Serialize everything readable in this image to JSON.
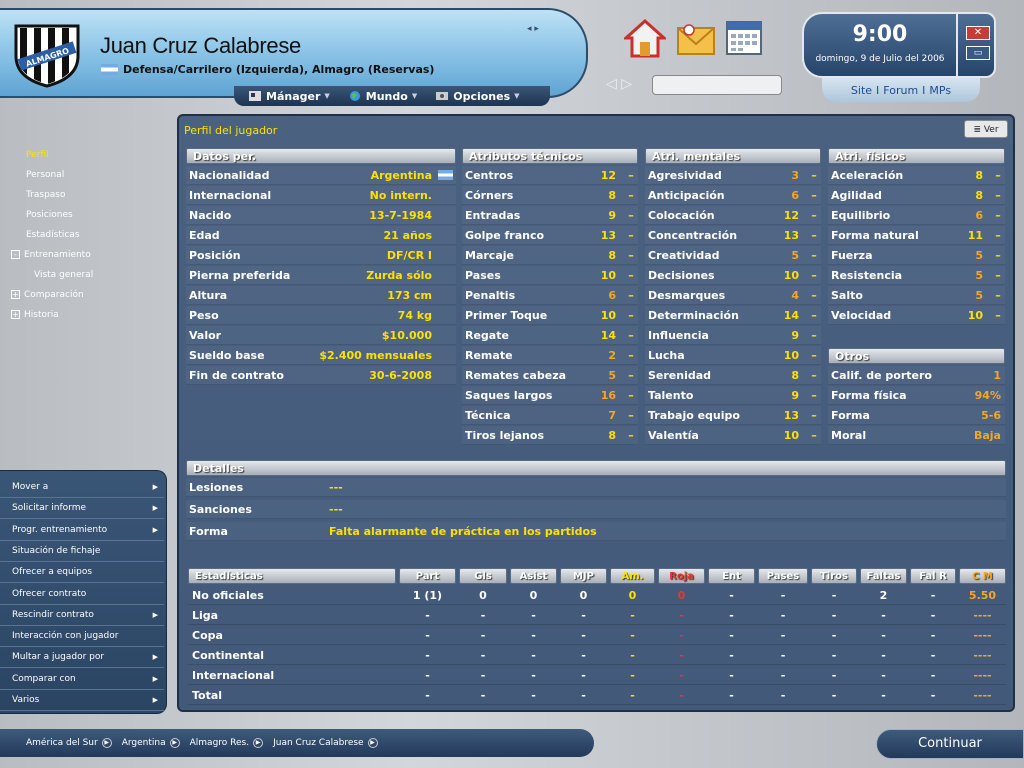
{
  "header": {
    "player_name": "Juan Cruz Calabrese",
    "player_subtitle": "Defensa/Carrilero (Izquierda), Almagro (Reservas)",
    "crest_text": "ALMAGRO",
    "menu": [
      {
        "label": "Mánager",
        "icon": "manager-icon"
      },
      {
        "label": "Mundo",
        "icon": "globe-icon"
      },
      {
        "label": "Opciones",
        "icon": "options-icon"
      }
    ],
    "arrows": "◂ ▸",
    "nav_arrows": "◁ ▷"
  },
  "clock": {
    "time": "9:00",
    "date": "domingo, 9 de Julio del 2006"
  },
  "window": {
    "close": "✕",
    "restore": "▭"
  },
  "site_links": [
    "Site",
    "Forum",
    "MPs"
  ],
  "site_sep": "I",
  "leftnav": [
    {
      "label": "Perfil",
      "active": true,
      "indent": 0,
      "box": ""
    },
    {
      "label": "Personal",
      "indent": 0,
      "box": ""
    },
    {
      "label": "Traspaso",
      "indent": 0,
      "box": ""
    },
    {
      "label": "Posiciones",
      "indent": 0,
      "box": ""
    },
    {
      "label": "Estadísticas",
      "indent": 0,
      "box": ""
    },
    {
      "label": "Entrenamiento",
      "indent": 0,
      "box": "-"
    },
    {
      "label": "Vista general",
      "indent": 1,
      "box": ""
    },
    {
      "label": "Comparación",
      "indent": 0,
      "box": "+"
    },
    {
      "label": "Historia",
      "indent": 0,
      "box": "+"
    }
  ],
  "actions": [
    {
      "label": "Mover a",
      "chev": true
    },
    {
      "label": "Solicitar informe",
      "chev": true
    },
    {
      "label": "Progr. entrenamiento",
      "chev": true
    },
    {
      "label": "Situación de fichaje",
      "chev": false
    },
    {
      "label": "Ofrecer a equipos",
      "chev": false
    },
    {
      "label": "Ofrecer contrato",
      "chev": false
    },
    {
      "label": "Rescindir contrato",
      "chev": true
    },
    {
      "label": "Interacción con jugador",
      "chev": false
    },
    {
      "label": "Multar a jugador por",
      "chev": true
    },
    {
      "label": "Comparar con",
      "chev": true
    },
    {
      "label": "Varios",
      "chev": true
    }
  ],
  "panel": {
    "title": "Perfil del jugador",
    "ver_label": "Ver"
  },
  "datos": {
    "header": "Datos per.",
    "rows": [
      {
        "label": "Nacionalidad",
        "value": "Argentina",
        "flag": true
      },
      {
        "label": "Internacional",
        "value": "No intern."
      },
      {
        "label": "Nacido",
        "value": "13-7-1984"
      },
      {
        "label": "Edad",
        "value": "21 años"
      },
      {
        "label": "Posición",
        "value": "DF/CR I"
      },
      {
        "label": "Pierna preferida",
        "value": "Zurda sólo"
      },
      {
        "label": "Altura",
        "value": "173 cm"
      },
      {
        "label": "Peso",
        "value": "74 kg"
      },
      {
        "label": "Valor",
        "value": "$10.000"
      },
      {
        "label": "Sueldo base",
        "value": "$2.400 mensuales"
      },
      {
        "label": "Fin de contrato",
        "value": "30-6-2008"
      }
    ]
  },
  "tecnicos": {
    "header": "Atributos técnicos",
    "rows": [
      {
        "label": "Centros",
        "value": "12",
        "tone": "y"
      },
      {
        "label": "Córners",
        "value": "8",
        "tone": "y"
      },
      {
        "label": "Entradas",
        "value": "9",
        "tone": "y"
      },
      {
        "label": "Golpe franco",
        "value": "13",
        "tone": "y"
      },
      {
        "label": "Marcaje",
        "value": "8",
        "tone": "y"
      },
      {
        "label": "Pases",
        "value": "10",
        "tone": "y"
      },
      {
        "label": "Penaltis",
        "value": "6",
        "tone": "o"
      },
      {
        "label": "Primer Toque",
        "value": "10",
        "tone": "y"
      },
      {
        "label": "Regate",
        "value": "14",
        "tone": "y"
      },
      {
        "label": "Remate",
        "value": "2",
        "tone": "o"
      },
      {
        "label": "Remates cabeza",
        "value": "5",
        "tone": "o"
      },
      {
        "label": "Saques largos",
        "value": "16",
        "tone": "o"
      },
      {
        "label": "Técnica",
        "value": "7",
        "tone": "o"
      },
      {
        "label": "Tiros lejanos",
        "value": "8",
        "tone": "y"
      }
    ]
  },
  "mentales": {
    "header": "Atri. mentales",
    "rows": [
      {
        "label": "Agresividad",
        "value": "3",
        "tone": "o"
      },
      {
        "label": "Anticipación",
        "value": "6",
        "tone": "o"
      },
      {
        "label": "Colocación",
        "value": "12",
        "tone": "y"
      },
      {
        "label": "Concentración",
        "value": "13",
        "tone": "y"
      },
      {
        "label": "Creatividad",
        "value": "5",
        "tone": "o"
      },
      {
        "label": "Decisiones",
        "value": "10",
        "tone": "y"
      },
      {
        "label": "Desmarques",
        "value": "4",
        "tone": "o"
      },
      {
        "label": "Determinación",
        "value": "14",
        "tone": "y"
      },
      {
        "label": "Influencia",
        "value": "9",
        "tone": "y"
      },
      {
        "label": "Lucha",
        "value": "10",
        "tone": "y"
      },
      {
        "label": "Serenidad",
        "value": "8",
        "tone": "y"
      },
      {
        "label": "Talento",
        "value": "9",
        "tone": "y"
      },
      {
        "label": "Trabajo equipo",
        "value": "13",
        "tone": "y"
      },
      {
        "label": "Valentía",
        "value": "10",
        "tone": "y"
      }
    ]
  },
  "fisicos": {
    "header": "Atri. físicos",
    "rows": [
      {
        "label": "Aceleración",
        "value": "8",
        "tone": "y"
      },
      {
        "label": "Agilidad",
        "value": "8",
        "tone": "y"
      },
      {
        "label": "Equilibrio",
        "value": "6",
        "tone": "o"
      },
      {
        "label": "Forma natural",
        "value": "11",
        "tone": "y"
      },
      {
        "label": "Fuerza",
        "value": "5",
        "tone": "o"
      },
      {
        "label": "Resistencia",
        "value": "5",
        "tone": "o"
      },
      {
        "label": "Salto",
        "value": "5",
        "tone": "o"
      },
      {
        "label": "Velocidad",
        "value": "10",
        "tone": "y"
      }
    ]
  },
  "otros": {
    "header": "Otros",
    "rows": [
      {
        "label": "Calif. de portero",
        "value": "1",
        "tone": "o"
      },
      {
        "label": "Forma física",
        "value": "94%",
        "tone": "o"
      },
      {
        "label": "Forma",
        "value": "5-6",
        "tone": "o"
      },
      {
        "label": "Moral",
        "value": "Baja",
        "tone": "o"
      }
    ]
  },
  "dash": "–",
  "detalles": {
    "header": "Detalles",
    "rows": [
      {
        "label": "Lesiones",
        "value": "---"
      },
      {
        "label": "Sanciones",
        "value": "---"
      },
      {
        "label": "Forma",
        "value": "Falta alarmante de práctica en los partidos"
      }
    ]
  },
  "stats": {
    "columns": [
      "Estadísticas",
      "Part",
      "Gls",
      "Asist",
      "MJP",
      "Am.",
      "Roja",
      "Ent",
      "Pases",
      "Tiros",
      "Faltas",
      "Fal R",
      "C M"
    ],
    "rows": [
      {
        "label": "No oficiales",
        "cells": [
          "1 (1)",
          "0",
          "0",
          "0",
          "0",
          "0",
          "-",
          "-",
          "-",
          "2",
          "-",
          "5.50"
        ]
      },
      {
        "label": "Liga",
        "cells": [
          "-",
          "-",
          "-",
          "-",
          "-",
          "-",
          "-",
          "-",
          "-",
          "-",
          "-",
          "----"
        ]
      },
      {
        "label": "Copa",
        "cells": [
          "-",
          "-",
          "-",
          "-",
          "-",
          "-",
          "-",
          "-",
          "-",
          "-",
          "-",
          "----"
        ]
      },
      {
        "label": "Continental",
        "cells": [
          "-",
          "-",
          "-",
          "-",
          "-",
          "-",
          "-",
          "-",
          "-",
          "-",
          "-",
          "----"
        ]
      },
      {
        "label": "Internacional",
        "cells": [
          "-",
          "-",
          "-",
          "-",
          "-",
          "-",
          "-",
          "-",
          "-",
          "-",
          "-",
          "----"
        ]
      },
      {
        "label": "Total",
        "cells": [
          "-",
          "-",
          "-",
          "-",
          "-",
          "-",
          "-",
          "-",
          "-",
          "-",
          "-",
          "----"
        ]
      }
    ]
  },
  "breadcrumb": [
    "América del Sur",
    "Argentina",
    "Almagro Res.",
    "Juan Cruz Calabrese"
  ],
  "continuar_label": "Continuar",
  "colors": {
    "accent": "#ffe100",
    "orange": "#f5a623",
    "red": "#e53a2a",
    "panel": "#4a6180"
  }
}
